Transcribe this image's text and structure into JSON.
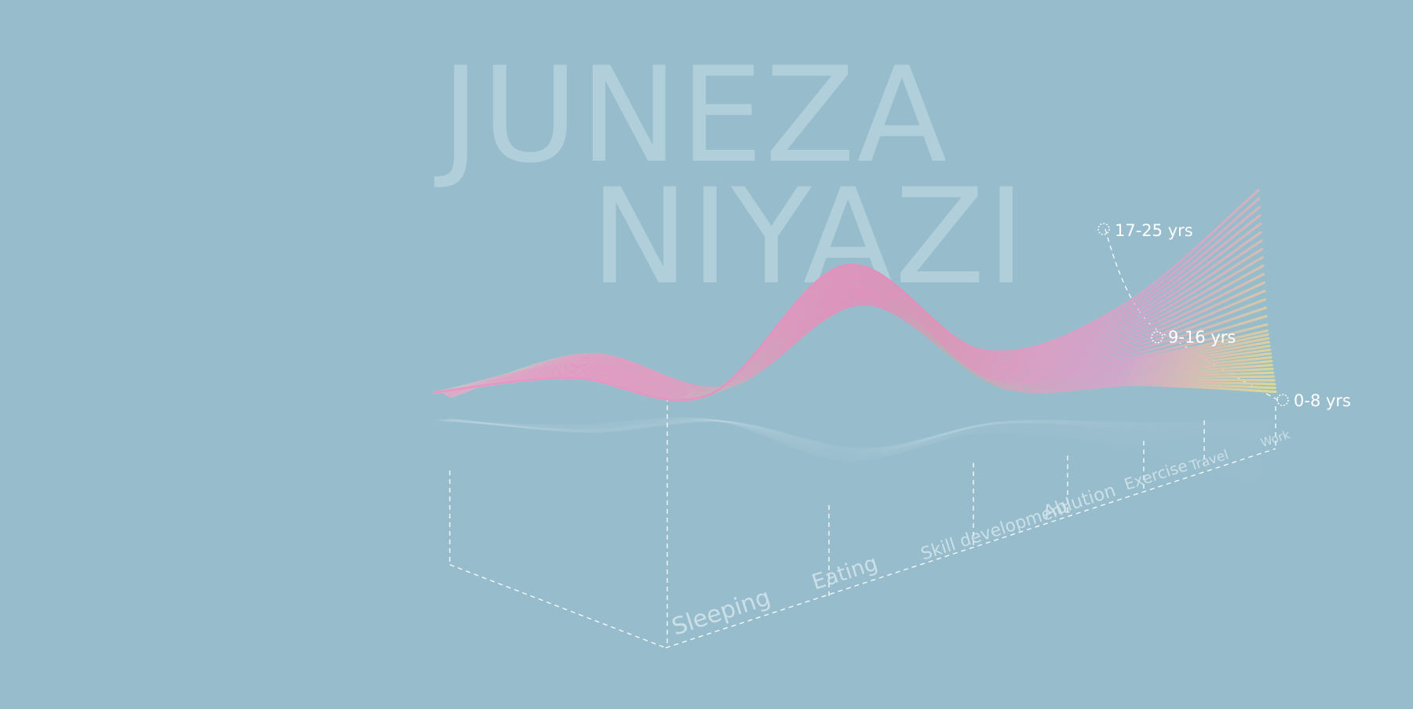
{
  "title": {
    "line1": "JUNEZA",
    "line2": "NIYAZI"
  },
  "chart_data": {
    "type": "area",
    "categories": [
      "Sleeping",
      "Eating",
      "Skill development",
      "Ablution",
      "Exercise",
      "Travel",
      "Work"
    ],
    "series": [
      {
        "name": "0-8 yrs",
        "values": [
          0.5,
          0.72,
          0.42,
          0.92,
          0.28,
          0.22,
          0.1
        ]
      },
      {
        "name": "9-16 yrs",
        "values": [
          0.48,
          0.6,
          0.34,
          1.0,
          0.28,
          0.34,
          0.48
        ]
      },
      {
        "name": "17-25 yrs",
        "values": [
          0.42,
          0.45,
          0.26,
          1.08,
          0.42,
          0.65,
          1.38
        ]
      }
    ],
    "gradients": {
      "left": [
        "#9fe8c7",
        "#72cca3"
      ],
      "middle": [
        "#fbe0ee",
        "#f6c7d9",
        "#ffe8c6"
      ],
      "right": [
        "#f074b8",
        "#d88ad8",
        "#e9e67a"
      ]
    },
    "colors": {
      "background": "#97bccc",
      "title": "#b0cfdb",
      "guides": "#ffffff"
    },
    "series_count_drawn": 34
  }
}
